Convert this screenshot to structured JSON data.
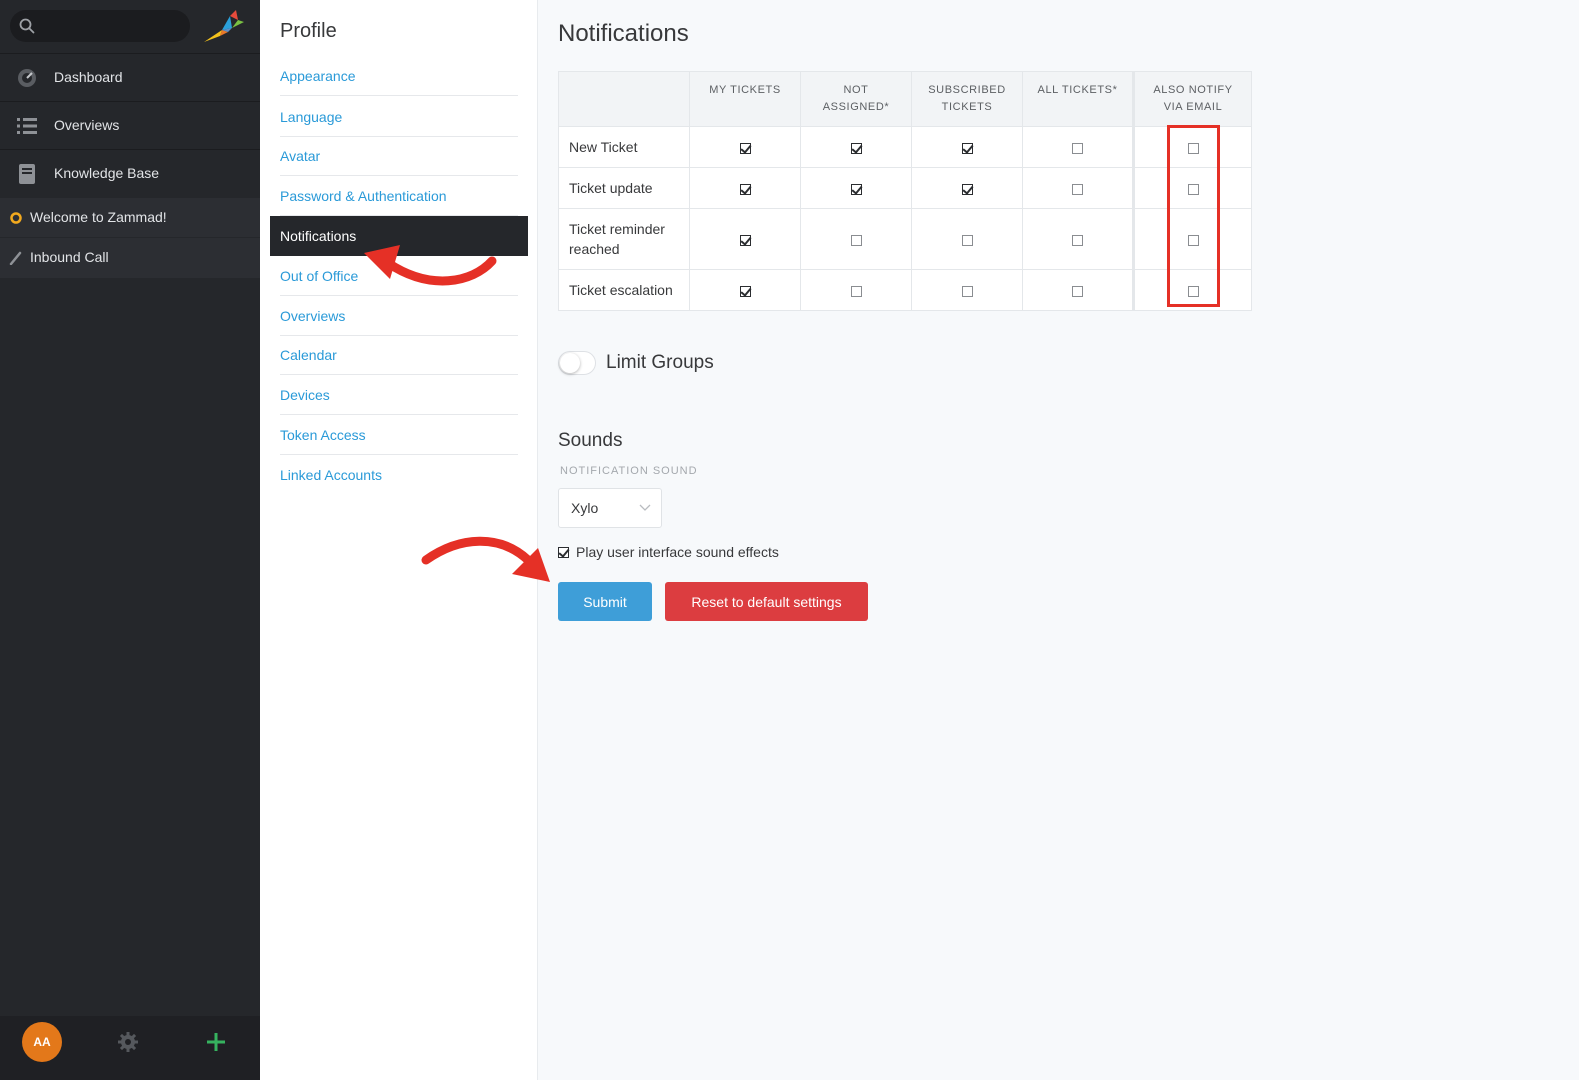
{
  "nav": {
    "items": [
      {
        "label": "Dashboard",
        "icon": "dashboard-icon"
      },
      {
        "label": "Overviews",
        "icon": "list-icon"
      },
      {
        "label": "Knowledge Base",
        "icon": "book-icon"
      }
    ],
    "tasks": [
      {
        "label": "Welcome to Zammad!",
        "icon": "ticket-open-icon"
      },
      {
        "label": "Inbound Call",
        "icon": "pencil-icon"
      }
    ],
    "avatar_initials": "AA"
  },
  "profile_nav": {
    "title": "Profile",
    "items": [
      {
        "label": "Appearance"
      },
      {
        "label": "Language"
      },
      {
        "label": "Avatar"
      },
      {
        "label": "Password & Authentication"
      },
      {
        "label": "Notifications"
      },
      {
        "label": "Out of Office"
      },
      {
        "label": "Overviews"
      },
      {
        "label": "Calendar"
      },
      {
        "label": "Devices"
      },
      {
        "label": "Token Access"
      },
      {
        "label": "Linked Accounts"
      }
    ],
    "active": "Notifications"
  },
  "main": {
    "title": "Notifications",
    "table": {
      "columns": [
        "MY TICKETS",
        "NOT ASSIGNED*",
        "SUBSCRIBED TICKETS",
        "ALL TICKETS*",
        "ALSO NOTIFY VIA EMAIL"
      ],
      "rows": [
        {
          "label": "New Ticket",
          "checks": [
            true,
            true,
            true,
            false,
            false
          ]
        },
        {
          "label": "Ticket update",
          "checks": [
            true,
            true,
            true,
            false,
            false
          ]
        },
        {
          "label": "Ticket reminder reached",
          "checks": [
            true,
            false,
            false,
            false,
            false
          ]
        },
        {
          "label": "Ticket escalation",
          "checks": [
            true,
            false,
            false,
            false,
            false
          ]
        }
      ]
    },
    "limit_groups_label": "Limit Groups",
    "limit_groups_enabled": false,
    "sounds_title": "Sounds",
    "notification_sound_label": "NOTIFICATION SOUND",
    "notification_sound_value": "Xylo",
    "play_sounds_label": "Play user interface sound effects",
    "play_sounds_checked": true,
    "submit_label": "Submit",
    "reset_label": "Reset to default settings"
  },
  "colors": {
    "nav_bg": "#25272b",
    "link": "#2a9ad8",
    "submit": "#3e9ed8",
    "reset": "#dc3d40",
    "annotation_red": "#e53026",
    "avatar": "#e3781a",
    "plus": "#36b35f",
    "task_dot": "#f2a91e"
  }
}
